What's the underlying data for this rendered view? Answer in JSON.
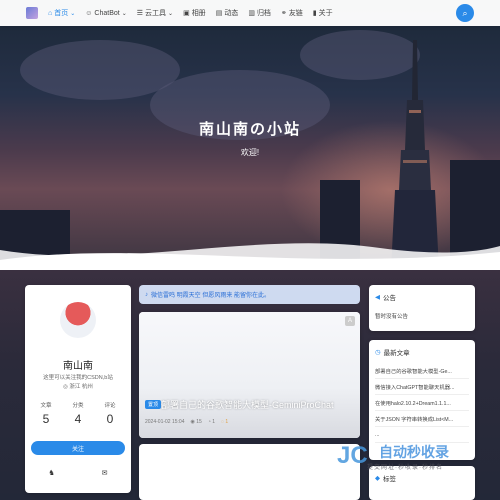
{
  "nav": {
    "items": [
      {
        "icon": "home-icon",
        "glyph": "⌂",
        "label": "首页",
        "chevron": "⌄",
        "active": true
      },
      {
        "icon": "robot-icon",
        "glyph": "☺",
        "label": "ChatBot",
        "chevron": "⌄",
        "active": false
      },
      {
        "icon": "tools-icon",
        "glyph": "☰",
        "label": "云工具",
        "chevron": "⌄",
        "active": false
      },
      {
        "icon": "album-icon",
        "glyph": "▣",
        "label": "相册",
        "chevron": "",
        "active": false
      },
      {
        "icon": "moments-icon",
        "glyph": "▤",
        "label": "动态",
        "chevron": "",
        "active": false
      },
      {
        "icon": "archive-icon",
        "glyph": "▥",
        "label": "归档",
        "chevron": "",
        "active": false
      },
      {
        "icon": "link-icon",
        "glyph": "⚭",
        "label": "友链",
        "chevron": "",
        "active": false
      },
      {
        "icon": "about-icon",
        "glyph": "▮",
        "label": "关于",
        "chevron": "",
        "active": false
      }
    ],
    "search_icon": "search-icon"
  },
  "hero": {
    "title": "南山南の小站",
    "subtitle": "欢迎!"
  },
  "profile": {
    "name": "南山南",
    "desc": "这里可以关注我的CSDN,b站",
    "location": "浙江 杭州",
    "location_icon": "location-icon",
    "stats": [
      {
        "label": "文章",
        "value": "5"
      },
      {
        "label": "分类",
        "value": "4"
      },
      {
        "label": "评论",
        "value": "0"
      }
    ],
    "follow_label": "关注",
    "icons": [
      "qq-icon",
      "mail-icon"
    ]
  },
  "notice": {
    "text": "微信雷鸣 明霞天空 但愿风雨来 能留你在此。",
    "icon": "bell-icon"
  },
  "post": {
    "ad_label": "A",
    "badge": "置顶",
    "title": "部署自己的谷歌智能大模型-GeminiProChat",
    "date": "2024-01-02 15:04",
    "views": "◉ 15",
    "likes": "◔ 1",
    "comments": "◌ 1"
  },
  "announcement": {
    "title": "公告",
    "icon": "megaphone-icon",
    "body": "暂时没有公告"
  },
  "recent": {
    "title": "最新文章",
    "icon": "clock-icon",
    "items": [
      "部署自己的谷歌智能大模型-Ge...",
      "微信接入ChatGPT智能聊天机器...",
      "在使用halo2.10.2+Dream1.1.1...",
      "关于JSON 字符串转换成List<M...",
      "..."
    ]
  },
  "widget3": {
    "title": "标签"
  },
  "watermark": {
    "logo": "JC",
    "text": "自动秒收录",
    "slogan": "提交网址·秒收录·秒排名"
  }
}
